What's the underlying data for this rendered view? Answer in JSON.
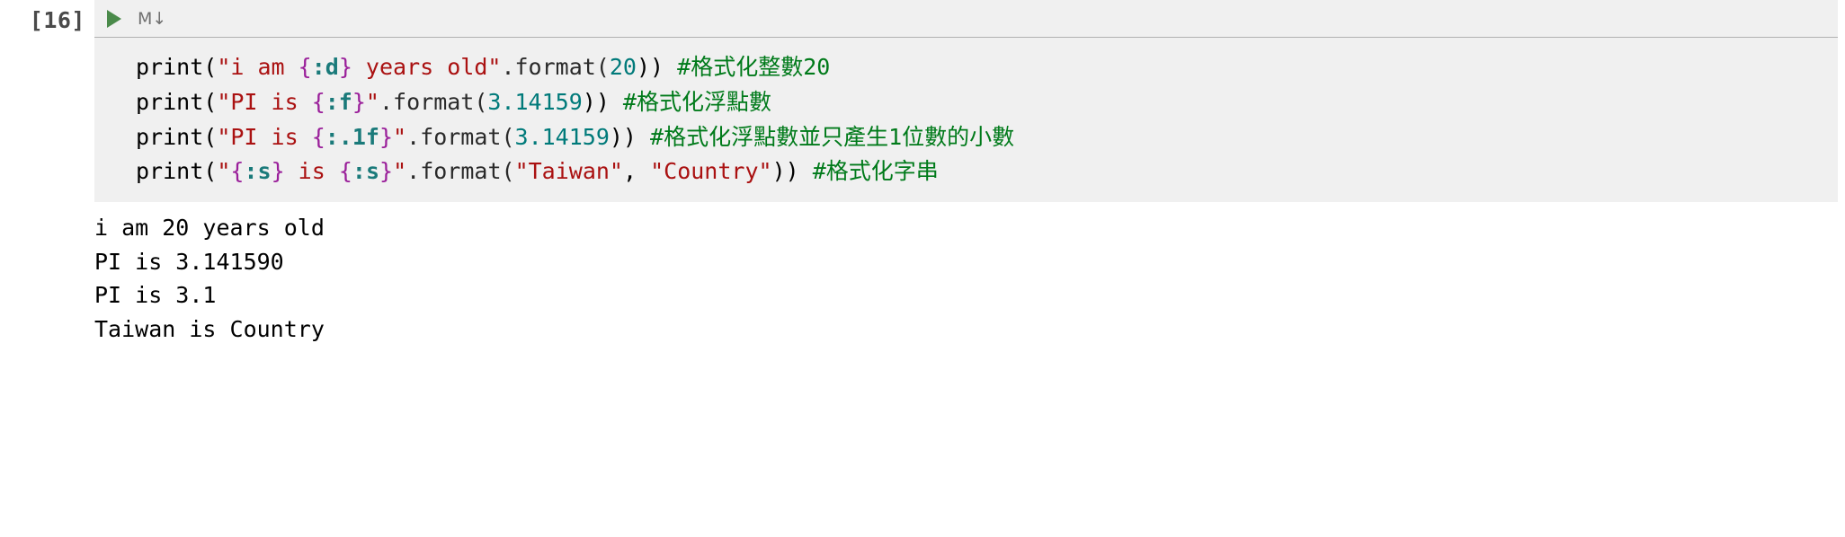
{
  "prompt": "[16]",
  "toolbar": {
    "run": "▷",
    "markdown": "M↓"
  },
  "code": {
    "l1": {
      "fn": "print",
      "s1": "\"i am ",
      "fmt_open": "{",
      "fmt_spec": ":d",
      "fmt_close": "}",
      "s2": " years old\"",
      "method": ".format(",
      "arg": "20",
      "close": ")) ",
      "comment": "#格式化整數20"
    },
    "l2": {
      "fn": "print",
      "s1": "\"PI is ",
      "fmt_open": "{",
      "fmt_spec": ":f",
      "fmt_close": "}",
      "s2": "\"",
      "method": ".format(",
      "arg": "3.14159",
      "close": ")) ",
      "comment": "#格式化浮點數"
    },
    "l3": {
      "fn": "print",
      "s1": "\"PI is ",
      "fmt_open": "{",
      "fmt_spec": ":.1f",
      "fmt_close": "}",
      "s2": "\"",
      "method": ".format(",
      "arg": "3.14159",
      "close": ")) ",
      "comment": "#格式化浮點數並只產生1位數的小數"
    },
    "l4": {
      "fn": "print",
      "s1": "\"",
      "fmt_open1": "{",
      "fmt_spec1": ":s",
      "fmt_close1": "}",
      "s2": " is ",
      "fmt_open2": "{",
      "fmt_spec2": ":s",
      "fmt_close2": "}",
      "s3": "\"",
      "method": ".format(",
      "arg1": "\"Taiwan\"",
      "sep": ", ",
      "arg2": "\"Country\"",
      "close": ")) ",
      "comment": "#格式化字串"
    }
  },
  "output": {
    "l1": "i am 20 years old",
    "l2": "PI is 3.141590",
    "l3": "PI is 3.1",
    "l4": "Taiwan is Country"
  }
}
